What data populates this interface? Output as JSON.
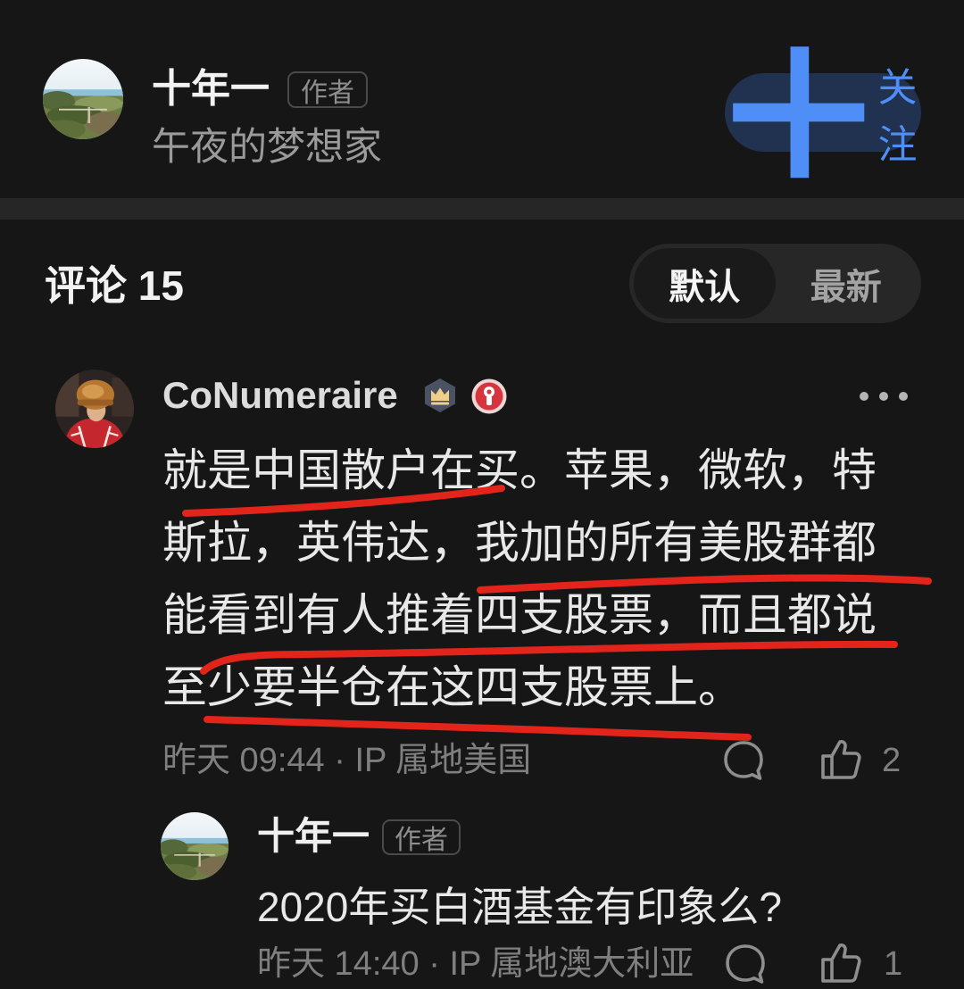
{
  "author_card": {
    "name": "十年一",
    "author_badge": "作者",
    "signature": "午夜的梦想家",
    "follow_button": "关注"
  },
  "comments_header": {
    "title": "评论",
    "count": "15",
    "sort_tabs": [
      {
        "label": "默认",
        "selected": true
      },
      {
        "label": "最新",
        "selected": false
      }
    ]
  },
  "meta_separator": "·",
  "comments": [
    {
      "author": "CoNumeraire",
      "badge_icons": [
        "crown-badge-icon",
        "red-medal-icon"
      ],
      "text_lines": [
        "就是中国散户在买。苹果，微软，特",
        "斯拉，英伟达，我加的所有美股群都",
        "能看到有人推着四支股票，而且都说",
        "至少要半仓在这四支股票上。"
      ],
      "time": "昨天 09:44",
      "ip_location": "IP 属地美国",
      "like_count": "2",
      "replies": [
        {
          "author": "十年一",
          "author_badge": "作者",
          "text": "2020年买白酒基金有印象么?",
          "time": "昨天 14:40",
          "ip_location": "IP 属地澳大利亚",
          "like_count": "1"
        }
      ]
    }
  ],
  "colors": {
    "background": "#161616",
    "divider_band": "#262626",
    "text_primary": "#e6e6e6",
    "text_secondary": "#7f7f7f",
    "accent_blue": "#4f8ef7",
    "follow_button_bg": "#213150",
    "annotation_red": "#e3241b"
  }
}
